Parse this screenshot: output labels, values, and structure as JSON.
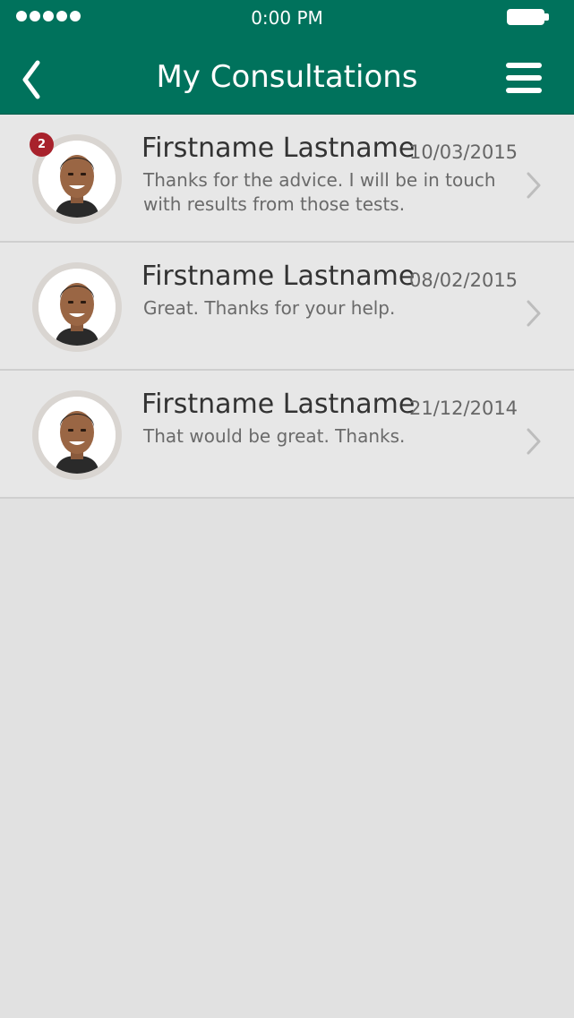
{
  "status_bar": {
    "time": "0:00 PM",
    "signal_icon": "signal-dots-icon",
    "battery_icon": "battery-icon"
  },
  "header": {
    "title": "My Consultations",
    "back_icon": "chevron-left-icon",
    "menu_icon": "hamburger-menu-icon",
    "color": "#00725c"
  },
  "consultations": [
    {
      "name": "Firstname Lastname",
      "date": "10/03/2015",
      "message": "Thanks for the advice. I will be in touch with results from those tests.",
      "badge": "2"
    },
    {
      "name": "Firstname Lastname",
      "date": "08/02/2015",
      "message": "Great. Thanks for your help."
    },
    {
      "name": "Firstname Lastname",
      "date": "21/12/2014",
      "message": "That would be great. Thanks."
    }
  ],
  "colors": {
    "badge": "#a8222c",
    "background": "#e1e1e1",
    "row": "#e7e7e7"
  }
}
